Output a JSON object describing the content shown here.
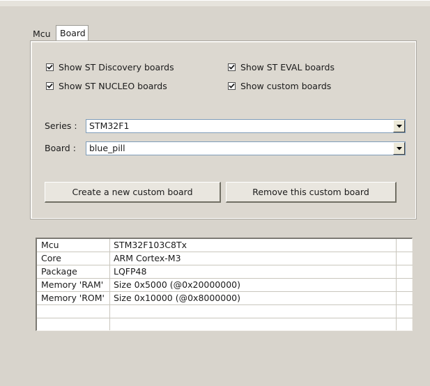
{
  "tabs": [
    {
      "label": "Mcu",
      "active": false
    },
    {
      "label": "Board",
      "active": true
    }
  ],
  "filters": {
    "discovery": {
      "label": "Show ST Discovery boards",
      "checked": true
    },
    "eval": {
      "label": "Show ST EVAL boards",
      "checked": true
    },
    "nucleo": {
      "label": "Show ST NUCLEO boards",
      "checked": true
    },
    "custom": {
      "label": "Show custom boards",
      "checked": true
    }
  },
  "series": {
    "label": "Series :",
    "value": "STM32F1"
  },
  "board": {
    "label": "Board :",
    "value": "blue_pill"
  },
  "buttons": {
    "create": "Create a new custom board",
    "remove": "Remove this custom board"
  },
  "details": {
    "rows": [
      {
        "key": "Mcu",
        "value": "STM32F103C8Tx"
      },
      {
        "key": "Core",
        "value": "ARM Cortex-M3"
      },
      {
        "key": "Package",
        "value": "LQFP48"
      },
      {
        "key": "Memory 'RAM'",
        "value": "Size 0x5000 (@0x20000000)"
      },
      {
        "key": "Memory 'ROM'",
        "value": "Size 0x10000 (@0x8000000)"
      }
    ]
  },
  "icons": {
    "checkbox_checked": "check-mark",
    "dropdown": "chevron-down-icon"
  },
  "colors": {
    "background": "#d8d4cc",
    "field_border": "#7f9db9",
    "text": "#1a1a1a"
  }
}
